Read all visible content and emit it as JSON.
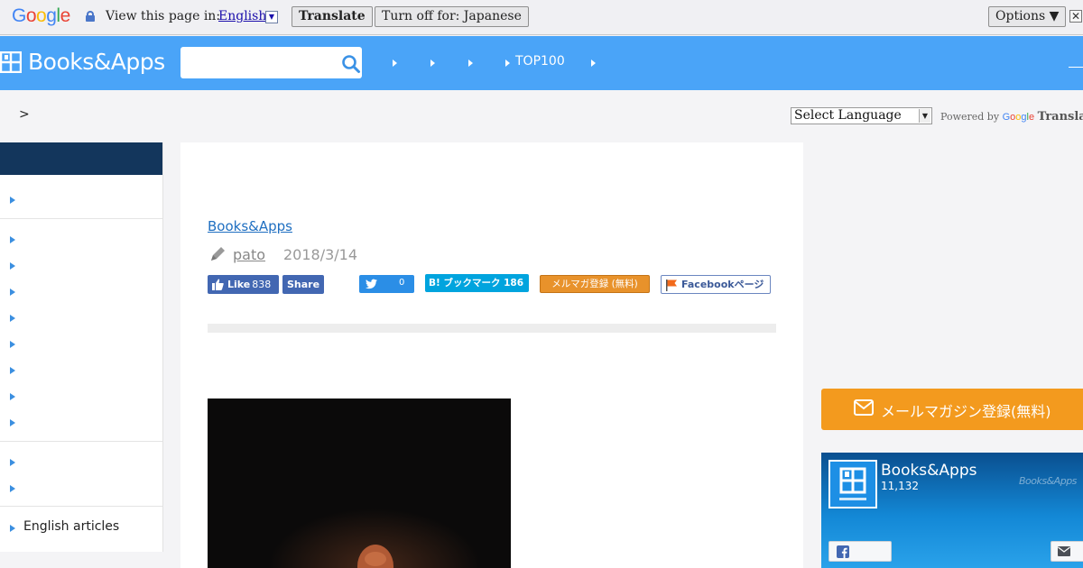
{
  "translate_bar": {
    "google_logo": "Google",
    "view_text": "View this page in:",
    "language": "English",
    "lang_arrow": "▼",
    "translate_button": "Translate",
    "turn_off_button": "Turn off for: Japanese",
    "options_button": "Options ▼",
    "close_glyph": "✕"
  },
  "header": {
    "logo_text": "Books&Apps",
    "nav_item_top100": "TOP100",
    "brand_color": "#4aa4f8"
  },
  "breadcrumb": {
    "separator": ">"
  },
  "google_translate_widget": {
    "select_label": "Select Language",
    "select_arrow": "▼",
    "powered_by": "Powered by",
    "google": "Google",
    "translate": "Translat"
  },
  "sidebar": {
    "english_articles": "English articles",
    "header_color": "#13365c"
  },
  "article": {
    "category": "Books&Apps",
    "author": "pato",
    "date": "2018/3/14",
    "fb_like_label": "Like",
    "fb_like_count": "838",
    "fb_share_label": "Share",
    "tweet_count": "0",
    "hatena_label": "B! ブックマーク 186",
    "mailmag_label": "メルマガ登録 (無料)",
    "fb_page_label": "Facebookページ"
  },
  "right_sidebar": {
    "mail_banner": "メールマガジン登録(無料)",
    "fb_page_name": "Books&Apps",
    "fb_followers": "11,132",
    "fb_brand_watermark": "Books&Apps",
    "accent_color": "#f39a1e"
  }
}
